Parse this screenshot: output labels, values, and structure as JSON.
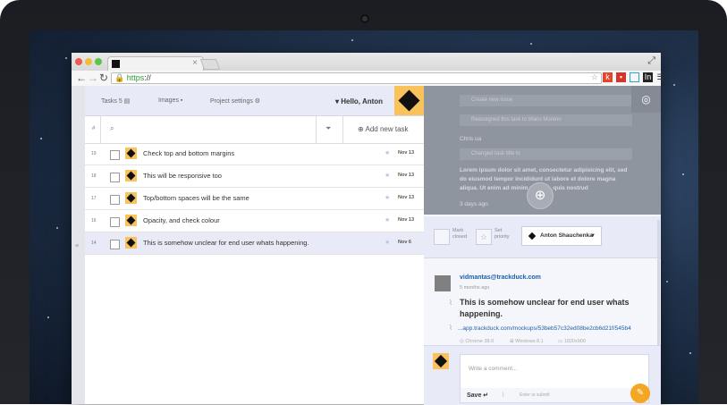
{
  "browser": {
    "url_scheme": "https",
    "url_rest": "://",
    "tab_close": "×"
  },
  "nav": {
    "tasks_label": "Tasks 5",
    "images_label": "Images",
    "project_settings_label": "Project settings",
    "greeting": "Hello, Anton",
    "add_task_label": "Add new task",
    "sort_label": "#"
  },
  "tasks": [
    {
      "id": "19",
      "title": "Check top and bottom margins",
      "date": "Nov 13",
      "selected": false
    },
    {
      "id": "18",
      "title": "This will be responsive too",
      "date": "Nov 13",
      "selected": false
    },
    {
      "id": "17",
      "title": "Top/bottom spaces will be the same",
      "date": "Nov 13",
      "selected": false
    },
    {
      "id": "16",
      "title": "Opacity, and check colour",
      "date": "Nov 13",
      "selected": false
    },
    {
      "id": "14",
      "title": "This is somehow unclear for end user whats happening.",
      "date": "Nov 6",
      "selected": true
    }
  ],
  "activity": {
    "items": [
      "Create new issue",
      "Reassigned this task to Mario Moreno",
      "Chris ua",
      "Changed task title to"
    ],
    "lorem": "Lorem ipsum dolor sit amet, consectetur adipisicing elit, sed do eiusmod tempor incididunt ut labore et dolore magna aliqua. Ut enim ad minim veniam, quis nostrud",
    "truncated_tail": "3 days ago"
  },
  "actions": {
    "mark_closed": "Mark closed",
    "set_priority": "Set priority",
    "assignee": "Anton Shauchenka"
  },
  "comment": {
    "author_email": "vidmantas@trackduck.com",
    "time_ago": "5 months ago",
    "title": "This is somehow unclear for end user whats happening.",
    "link": "...app.trackduck.com/mockups/53beb57c32ed08be2cb6d21f/545b4",
    "browser": "Chrome 38.0",
    "os": "Windows 8.1",
    "resolution": "1920x900"
  },
  "composer": {
    "placeholder": "Write a comment...",
    "save_label": "Save",
    "hint": "Enter to submit"
  },
  "colors": {
    "accent": "#f9c25b",
    "link": "#1a5fa8",
    "header_bg": "#e8ebf7"
  }
}
